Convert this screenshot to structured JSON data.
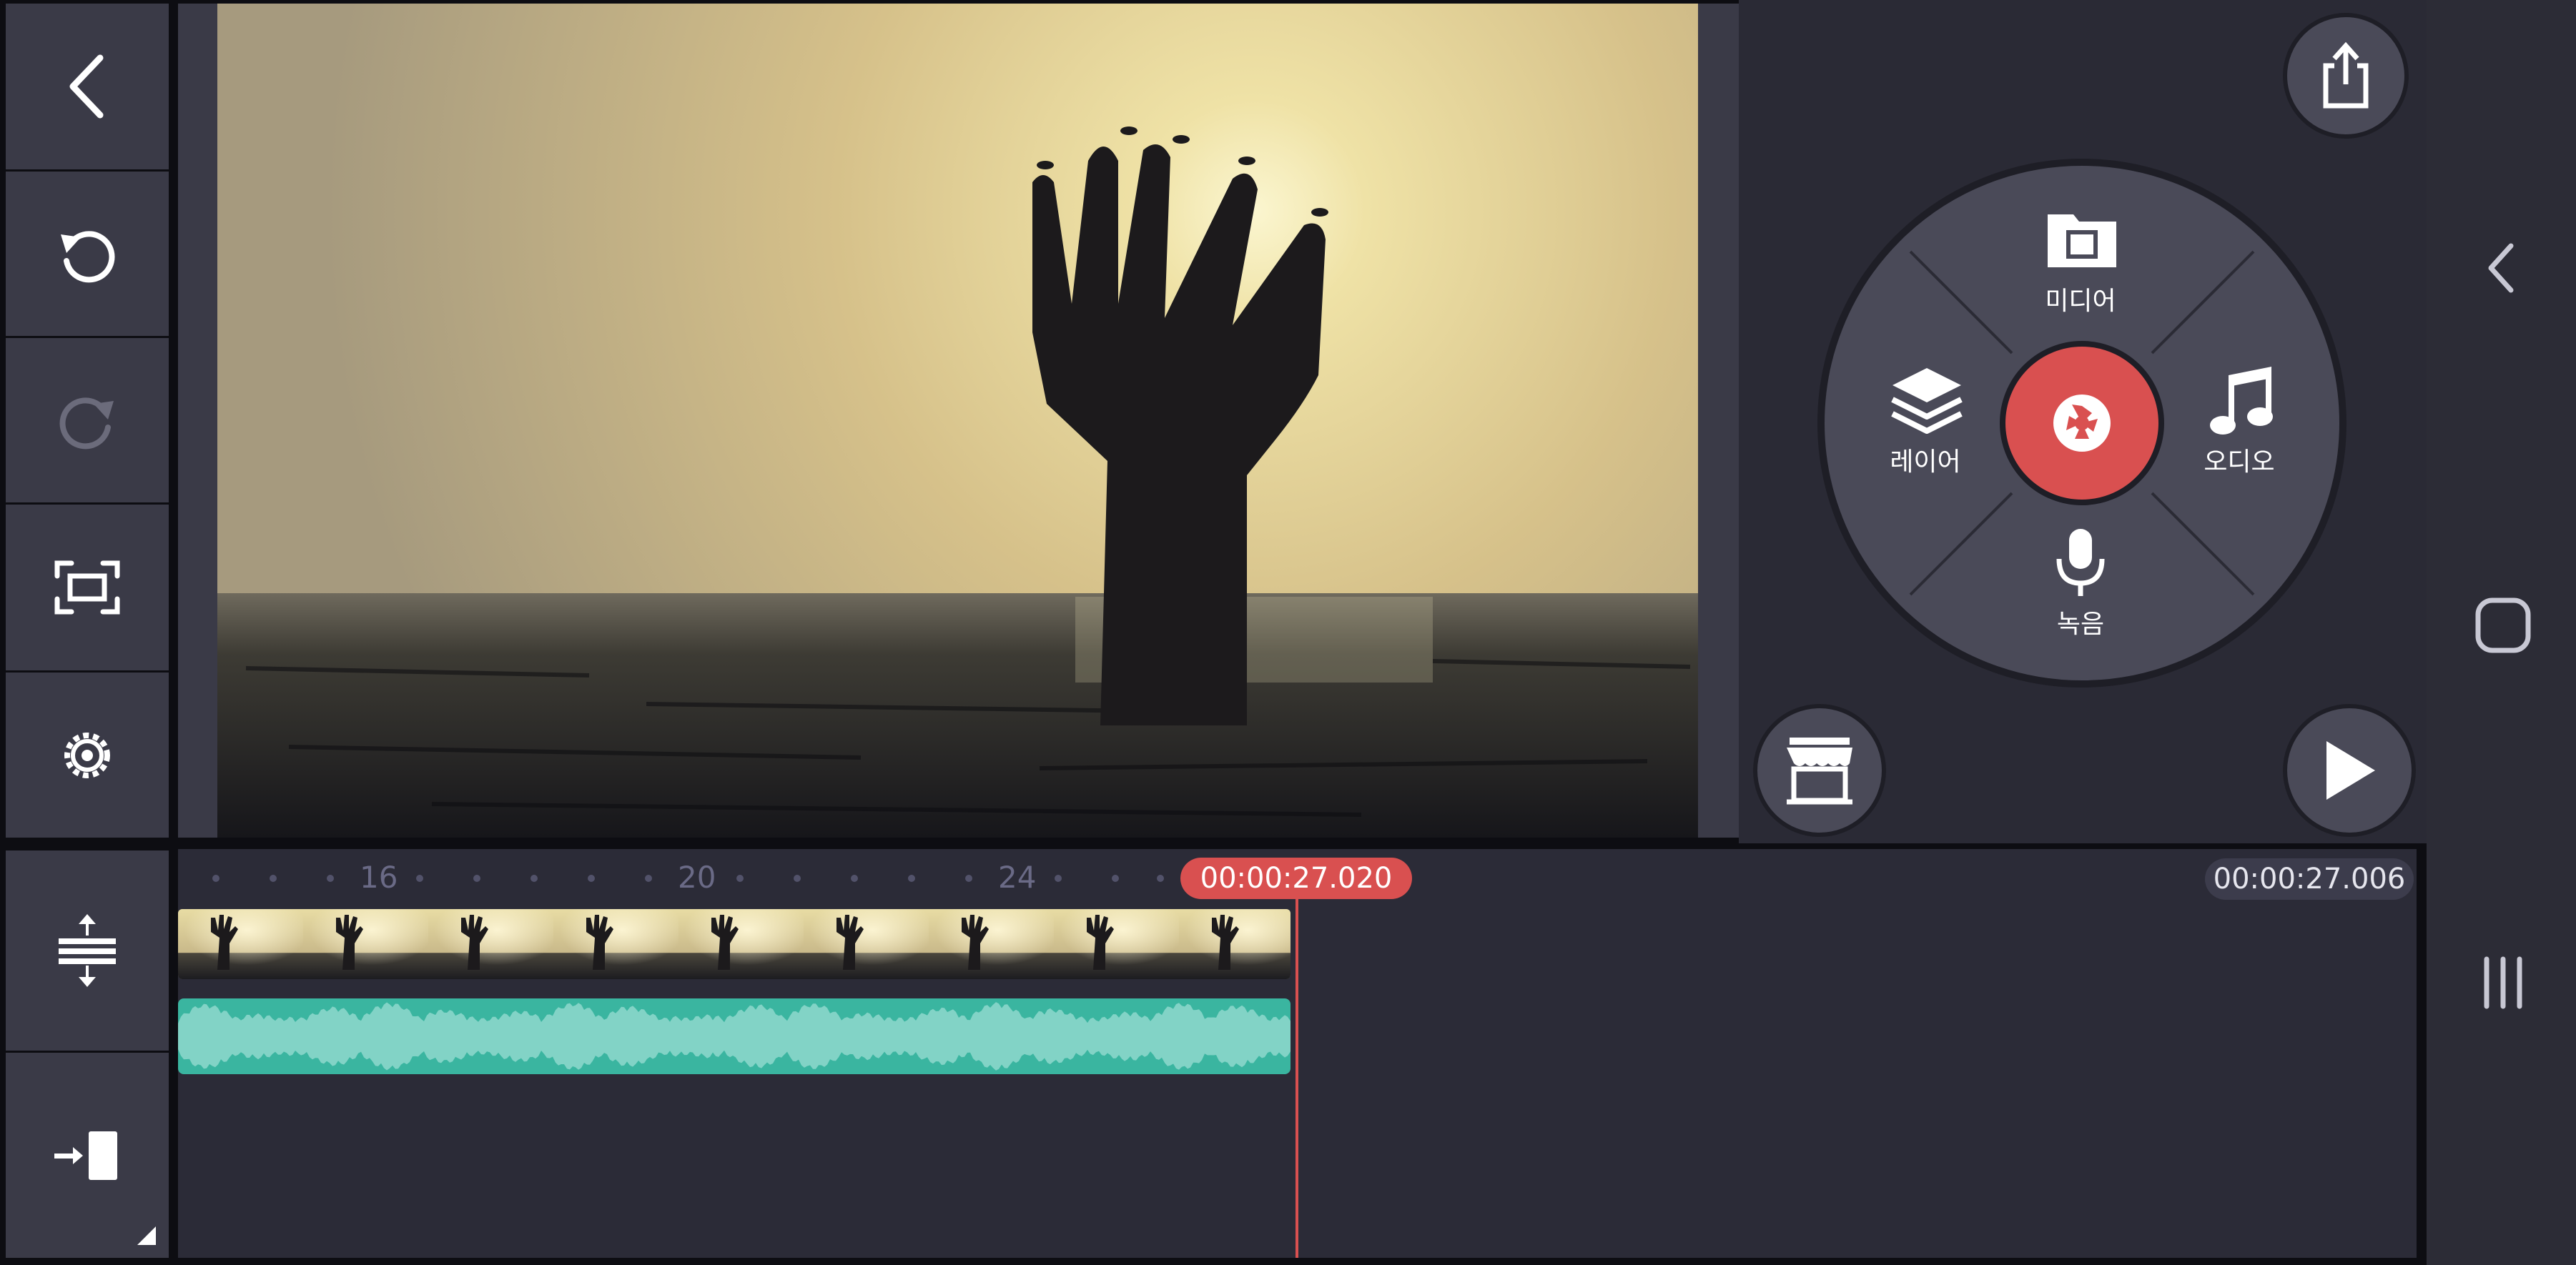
{
  "toolbar": {
    "icons": [
      "back-icon",
      "undo-icon",
      "redo-icon",
      "aspect-ratio-icon",
      "settings-icon"
    ]
  },
  "timeline_tools": {
    "icons": [
      "expand-tracks-icon",
      "jump-to-end-icon"
    ]
  },
  "media_wheel": {
    "media_label": "미디어",
    "layer_label": "레이어",
    "audio_label": "오디오",
    "record_label": "녹음"
  },
  "timeline": {
    "ruler_ticks": [
      "16",
      "20",
      "24"
    ],
    "playhead_time": "00:00:27.020",
    "total_duration": "00:00:27.006"
  },
  "colors": {
    "accent_red": "#d95050",
    "audio_clip": "#3ab5a0",
    "panel": "#3a3a47",
    "background": "#2b2b37"
  }
}
